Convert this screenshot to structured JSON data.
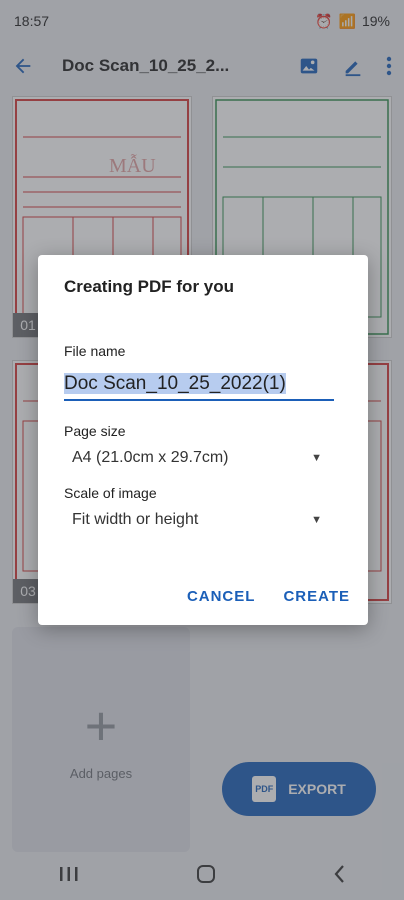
{
  "status": {
    "time": "18:57",
    "battery": "19%"
  },
  "appbar": {
    "title": "Doc Scan_10_25_2..."
  },
  "thumbnails": [
    {
      "label": "01",
      "color": "#d53a3a",
      "stamp": "MẪU"
    },
    {
      "label": "",
      "color": "#2f8f4e"
    },
    {
      "label": "03",
      "color": "#d53a3a"
    },
    {
      "label": "",
      "color": "#d53a3a"
    }
  ],
  "add_pages": {
    "label": "Add pages"
  },
  "fab": {
    "label": "EXPORT",
    "icon_text": "PDF"
  },
  "dialog": {
    "title": "Creating PDF for you",
    "file_name_label": "File name",
    "file_name_value": "Doc Scan_10_25_2022(1)",
    "page_size_label": "Page size",
    "page_size_value": "A4 (21.0cm x 29.7cm)",
    "scale_label": "Scale of image",
    "scale_value": "Fit width or height",
    "cancel_label": "CANCEL",
    "create_label": "CREATE"
  },
  "colors": {
    "accent": "#1b5fb8"
  }
}
